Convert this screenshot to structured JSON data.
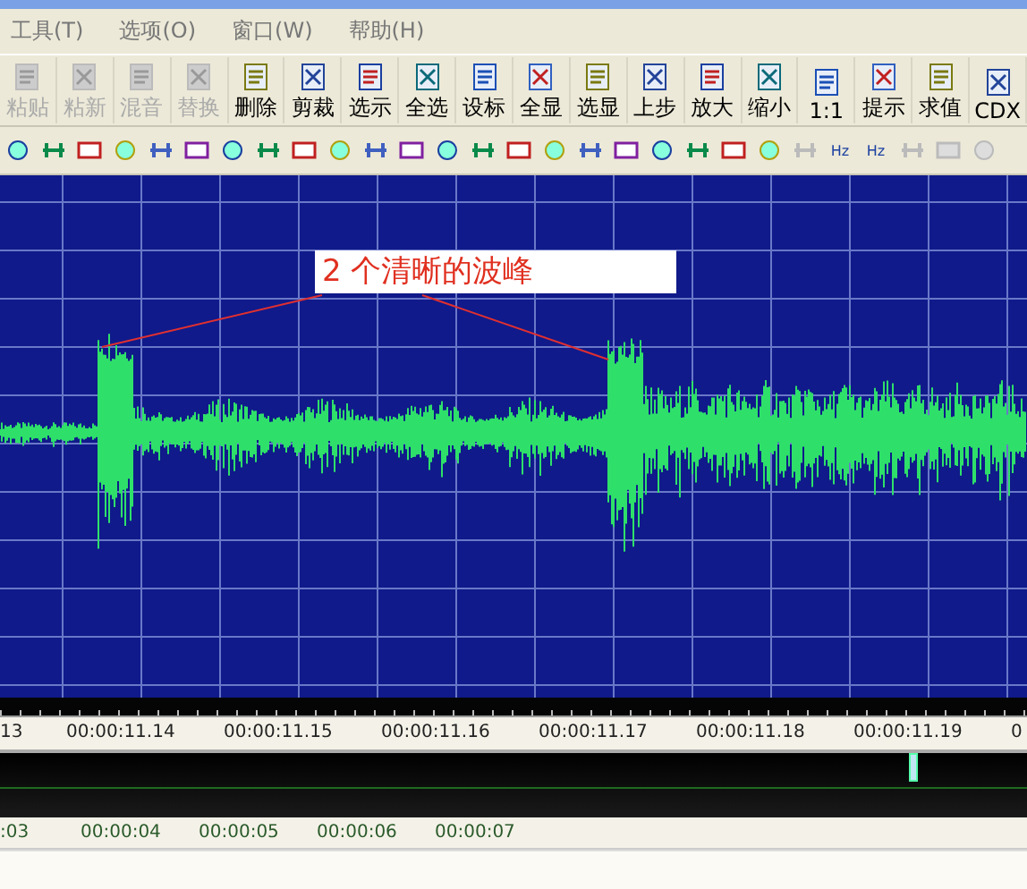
{
  "menu": [
    {
      "label": "工具(T)"
    },
    {
      "label": "选项(O)"
    },
    {
      "label": "窗口(W)"
    },
    {
      "label": "帮助(H)"
    }
  ],
  "toolbar": [
    {
      "label": "粘贴",
      "disabled": true
    },
    {
      "label": "粘新",
      "disabled": true
    },
    {
      "label": "混音",
      "disabled": true
    },
    {
      "label": "替换",
      "disabled": true
    },
    {
      "label": "删除",
      "disabled": false
    },
    {
      "label": "剪裁",
      "disabled": false
    },
    {
      "label": "选示",
      "disabled": false
    },
    {
      "label": "全选",
      "disabled": false
    },
    {
      "label": "设标",
      "disabled": false
    },
    {
      "label": "全显",
      "disabled": false
    },
    {
      "label": "选显",
      "disabled": false
    },
    {
      "label": "上步",
      "disabled": false
    },
    {
      "label": "放大",
      "disabled": false
    },
    {
      "label": "缩小",
      "disabled": false
    },
    {
      "label": "1:1",
      "disabled": false
    },
    {
      "label": "提示",
      "disabled": false
    },
    {
      "label": "求值",
      "disabled": false
    },
    {
      "label": "CDX",
      "disabled": false
    }
  ],
  "icon_toolbar": [
    {
      "disabled": false
    },
    {
      "disabled": false
    },
    {
      "disabled": false
    },
    {
      "disabled": false
    },
    {
      "disabled": false
    },
    {
      "disabled": false
    },
    {
      "disabled": false
    },
    {
      "disabled": false
    },
    {
      "disabled": false
    },
    {
      "disabled": false
    },
    {
      "disabled": false
    },
    {
      "disabled": false
    },
    {
      "disabled": false
    },
    {
      "disabled": false
    },
    {
      "disabled": false
    },
    {
      "disabled": false
    },
    {
      "disabled": false
    },
    {
      "disabled": false
    },
    {
      "disabled": false
    },
    {
      "disabled": false
    },
    {
      "disabled": false
    },
    {
      "disabled": false
    },
    {
      "disabled": true
    },
    {
      "label": "Hz",
      "disabled": false
    },
    {
      "label": "Hz",
      "disabled": false
    },
    {
      "disabled": true
    },
    {
      "disabled": true
    },
    {
      "disabled": true
    }
  ],
  "annotation": {
    "text": "2 个清晰的波峰"
  },
  "time_ruler": [
    "13",
    "00:00:11.14",
    "00:00:11.15",
    "00:00:11.16",
    "00:00:11.17",
    "00:00:11.18",
    "00:00:11.19",
    "0"
  ],
  "overview_ruler": [
    ":03",
    "00:00:04",
    "00:00:05",
    "00:00:06",
    "00:00:07"
  ]
}
